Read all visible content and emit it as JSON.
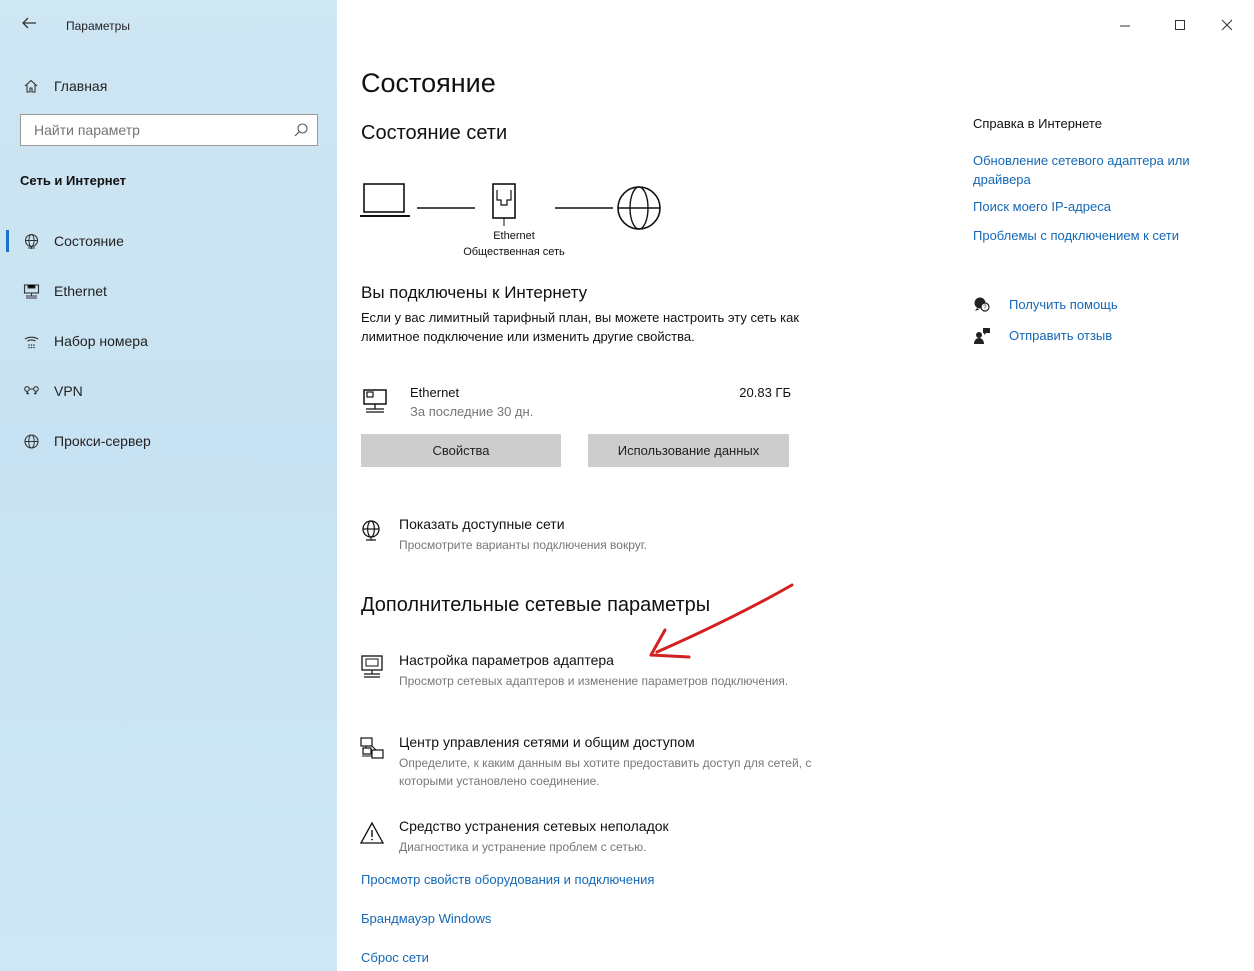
{
  "window": {
    "title": "Параметры",
    "controls": [
      "minimize-icon",
      "maximize-icon",
      "close-icon"
    ]
  },
  "sidebar": {
    "home_label": "Главная",
    "search_placeholder": "Найти параметр",
    "section_title": "Сеть и Интернет",
    "items": [
      {
        "label": "Состояние",
        "icon": "globe-icon",
        "selected": true
      },
      {
        "label": "Ethernet",
        "icon": "ethernet-icon",
        "selected": false
      },
      {
        "label": "Набор номера",
        "icon": "dialup-icon",
        "selected": false
      },
      {
        "label": "VPN",
        "icon": "vpn-icon",
        "selected": false
      },
      {
        "label": "Прокси-сервер",
        "icon": "globe-icon",
        "selected": false
      }
    ]
  },
  "main": {
    "page_title": "Состояние",
    "network_status_title": "Состояние сети",
    "diagram": {
      "adapter_name": "Ethernet",
      "network_type": "Общественная сеть"
    },
    "connected_title": "Вы подключены к Интернету",
    "connected_desc": "Если у вас лимитный тарифный план, вы можете настроить эту сеть как лимитное подключение или изменить другие свойства.",
    "adapter": {
      "name": "Ethernet",
      "period": "За последние 30 дн.",
      "usage": "20.83 ГБ"
    },
    "buttons": {
      "properties": "Свойства",
      "data_usage": "Использование данных"
    },
    "show_networks": {
      "title": "Показать доступные сети",
      "subtitle": "Просмотрите варианты подключения вокруг."
    },
    "advanced_title": "Дополнительные сетевые параметры",
    "advanced_items": [
      {
        "title": "Настройка параметров адаптера",
        "subtitle": "Просмотр сетевых адаптеров и изменение параметров подключения.",
        "icon": "adapter-icon"
      },
      {
        "title": "Центр управления сетями и общим доступом",
        "subtitle": "Определите, к каким данным вы хотите предоставить доступ для сетей, с которыми установлено соединение.",
        "icon": "sharing-center-icon"
      },
      {
        "title": "Средство устранения сетевых неполадок",
        "subtitle": "Диагностика и устранение проблем с сетью.",
        "icon": "warning-icon"
      }
    ],
    "links": [
      "Просмотр свойств оборудования и подключения",
      "Брандмауэр Windows",
      "Сброс сети"
    ]
  },
  "help": {
    "title": "Справка в Интернете",
    "links": [
      "Обновление сетевого адаптера или драйвера",
      "Поиск моего IP-адреса",
      "Проблемы с подключением к сети"
    ],
    "get_help": "Получить помощь",
    "feedback": "Отправить отзыв"
  },
  "colors": {
    "accent": "#1468b6",
    "sidebar_bg": "#cfe6f3",
    "button_bg": "#cdcdcd",
    "annotation_arrow": "#d42020"
  }
}
